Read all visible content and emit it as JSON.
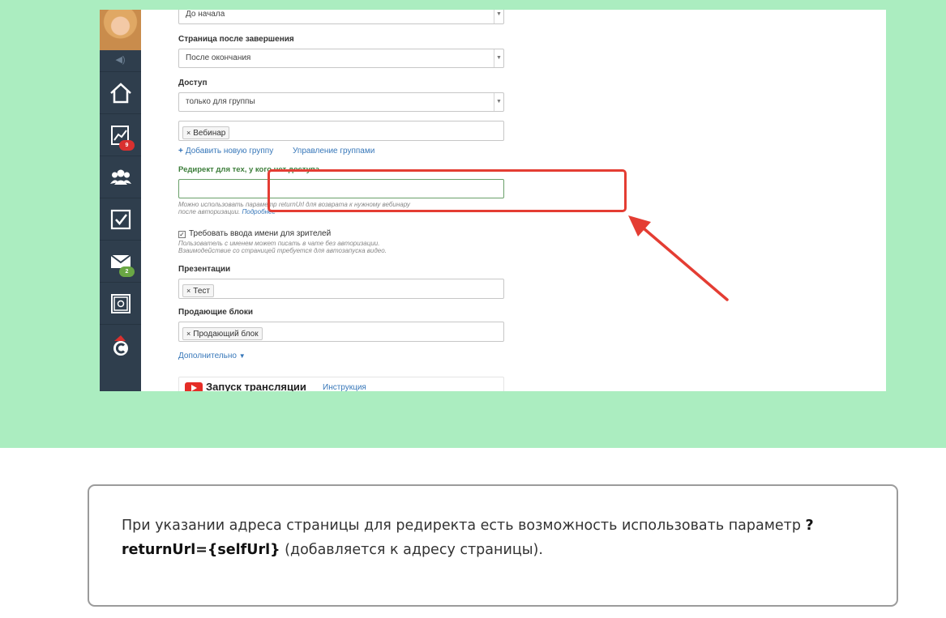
{
  "form": {
    "start_select": "До начала",
    "finish_label": "Страница после завершения",
    "finish_select": "После окончания",
    "access_label": "Доступ",
    "access_select": "только для группы",
    "group_tag": "Вебинар",
    "add_group_link": "Добавить новую группу",
    "manage_groups_link": "Управление группами",
    "redirect_label": "Редирект для тех, у кого нет доступа",
    "redirect_value": "",
    "redirect_hint_line1": "Можно использовать параметр returnUrl для возврата к нужному вебинару",
    "redirect_hint_line2": "после авторизации.",
    "redirect_hint_link": "Подробнее",
    "require_name_label": "Требовать ввода имени для зрителей",
    "require_name_checked": true,
    "require_name_hint_line1": "Пользователь с именем может писать в чате без авторизации.",
    "require_name_hint_line2": "Взаимодействие со страницей требуется для автозапуска видео.",
    "presentations_label": "Презентации",
    "presentation_tag": "Тест",
    "selling_blocks_label": "Продающие блоки",
    "selling_block_tag": "Продающий блок",
    "more_link": "Дополнительно",
    "stream_title": "Запуск трансляции",
    "stream_instruction_link": "Инструкция"
  },
  "sidebar": {
    "badges": {
      "stats": "9",
      "messages": "2"
    },
    "icons": [
      "home-icon",
      "chart-icon",
      "users-icon",
      "tasks-icon",
      "mail-icon",
      "safe-icon",
      "c-logo-icon"
    ]
  },
  "note": {
    "text_before": "При указании адреса страницы для редиректа есть возможность использовать параметр ",
    "param": "?returnUrl={selfUrl}",
    "text_after": " (добавляется к адресу страницы)."
  },
  "colors": {
    "background": "#abedc0",
    "highlight": "#e43d33",
    "sidebar": "#2f3e4d",
    "link": "#3777b9"
  }
}
